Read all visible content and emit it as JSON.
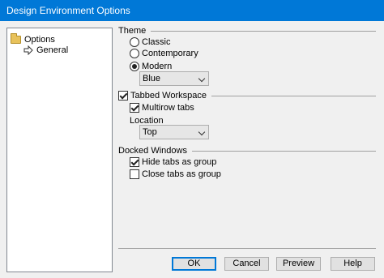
{
  "window": {
    "title": "Design Environment Options"
  },
  "tree": {
    "root_label": "Options",
    "child_label": "General",
    "root_icon": "folder-icon",
    "child_icon": "arrow-icon"
  },
  "theme": {
    "header": "Theme",
    "options": [
      "Classic",
      "Contemporary",
      "Modern"
    ],
    "selected": "Modern",
    "color_value": "Blue"
  },
  "tabbed": {
    "header": "Tabbed Workspace",
    "checked": true,
    "multirow_label": "Multirow tabs",
    "multirow_checked": true,
    "location_label": "Location",
    "location_value": "Top"
  },
  "docked": {
    "header": "Docked Windows",
    "hide_label": "Hide tabs as group",
    "hide_checked": true,
    "close_label": "Close tabs as group",
    "close_checked": false
  },
  "buttons": {
    "ok": "OK",
    "cancel": "Cancel",
    "preview": "Preview",
    "help": "Help"
  }
}
